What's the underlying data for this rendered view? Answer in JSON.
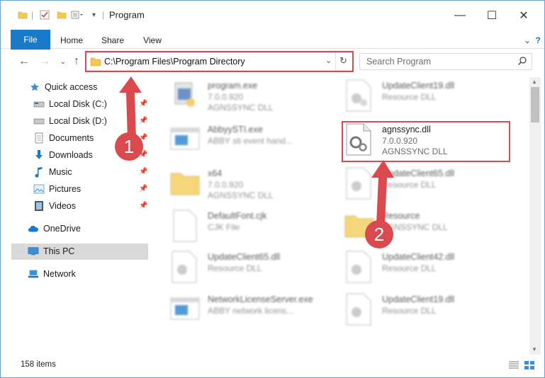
{
  "window": {
    "title": "Program",
    "minimize_glyph": "—",
    "maximize_glyph": "☐",
    "close_glyph": "✕"
  },
  "ribbon": {
    "tabs": [
      "File",
      "Home",
      "Share",
      "View"
    ]
  },
  "address": {
    "path": "C:\\Program Files\\Program Directory",
    "search_placeholder": "Search Program"
  },
  "sidebar": {
    "items": [
      {
        "label": "Quick access",
        "icon": "star-icon",
        "pinned": false
      },
      {
        "label": "Local Disk (C:)",
        "icon": "drive-icon",
        "pinned": true
      },
      {
        "label": "Local Disk (D:)",
        "icon": "drive-icon",
        "pinned": true
      },
      {
        "label": "Documents",
        "icon": "documents-icon",
        "pinned": true
      },
      {
        "label": "Downloads",
        "icon": "download-icon",
        "pinned": true
      },
      {
        "label": "Music",
        "icon": "music-icon",
        "pinned": true
      },
      {
        "label": "Pictures",
        "icon": "pictures-icon",
        "pinned": true
      },
      {
        "label": "Videos",
        "icon": "videos-icon",
        "pinned": true
      },
      {
        "label": "OneDrive",
        "icon": "cloud-icon",
        "pinned": false
      },
      {
        "label": "This PC",
        "icon": "pc-icon",
        "pinned": false
      },
      {
        "label": "Network",
        "icon": "network-icon",
        "pinned": false
      }
    ]
  },
  "files": [
    {
      "name": "program.exe",
      "line1": "7.0.0.920",
      "line2": "AGNSSYNC DLL",
      "kind": "exe"
    },
    {
      "name": "UpdateClient19.dll",
      "line1": "Resource DLL",
      "line2": "",
      "kind": "dll"
    },
    {
      "name": "AbbyySTI.exe",
      "line1": "ABBY sti event hand...",
      "line2": "",
      "kind": "app"
    },
    {
      "name": "agnssync.dll",
      "line1": "7.0.0.920",
      "line2": "AGNSSYNC DLL",
      "kind": "dll"
    },
    {
      "name": "x64",
      "line1": "7.0.0.920",
      "line2": "AGNSSYNC DLL",
      "kind": "folder"
    },
    {
      "name": "UpdateClient65.dll",
      "line1": "Resource DLL",
      "line2": "",
      "kind": "dll"
    },
    {
      "name": "DefaultFont.cjk",
      "line1": "CJK File",
      "line2": "",
      "kind": "blank"
    },
    {
      "name": "Resource",
      "line1": "AGNSSYNC DLL",
      "line2": "",
      "kind": "folder"
    },
    {
      "name": "UpdateClient65.dll",
      "line1": "Resource DLL",
      "line2": "",
      "kind": "dll"
    },
    {
      "name": "UpdateClient42.dll",
      "line1": "Resource DLL",
      "line2": "",
      "kind": "dll"
    },
    {
      "name": "NetworkLicenseServer.exe",
      "line1": "ABBY network licens...",
      "line2": "",
      "kind": "app"
    },
    {
      "name": "UpdateClient19.dll",
      "line1": "Resource DLL",
      "line2": "",
      "kind": "dll"
    }
  ],
  "status": {
    "count": "158 items"
  },
  "markers": [
    "1",
    "2"
  ],
  "colors": {
    "accent": "#1979ca",
    "highlight": "#d9494e",
    "folder": "#f3c94e"
  }
}
